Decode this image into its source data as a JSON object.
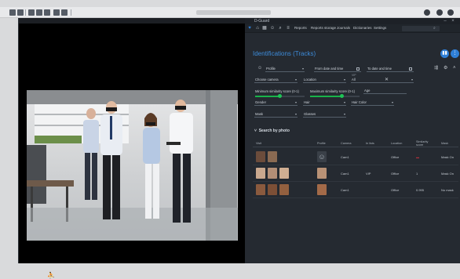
{
  "colors": {
    "accent": "#3d8bd9",
    "slider": "#19b34a",
    "background": "#252a31",
    "mask_text": "#b3303c"
  },
  "app": {
    "title": "D-Guard",
    "menu": [
      "Reports",
      "Reports storage",
      "Journals",
      "Dictionaries",
      "Settings"
    ]
  },
  "page": {
    "title": "Identifications (Tracks)"
  },
  "filters": {
    "profile": "Profile",
    "from_date": "From date and time",
    "to_date": "To date and time",
    "choose_camera": "Choose camera",
    "location": "Location",
    "vip_label": "VIP",
    "vip_value": "All",
    "min_similarity": "Minimum similarity score (0-1)",
    "max_similarity": "Maximum similarity score (0-1)",
    "age": "Age",
    "gender": "Gender",
    "hair": "Hair",
    "hair_color": "Hair Color",
    "mask": "Mask",
    "glasses": "Glasses",
    "min_similarity_level": 0.5,
    "max_similarity_level": 0.65
  },
  "search_by_photo": "Search by photo",
  "table": {
    "columns": [
      "Visit",
      "Profile",
      "Camera",
      "In lists",
      "Location",
      "Similarity score",
      "Mask"
    ],
    "rows": [
      {
        "camera": "Cam1",
        "lists": "",
        "location": "Office",
        "score": "",
        "mask": "Mask On",
        "score_red": true
      },
      {
        "camera": "Cam1",
        "lists": "VIP",
        "location": "Office",
        "score": "1",
        "mask": "Mask On",
        "score_red": false
      },
      {
        "camera": "Cam1",
        "lists": "",
        "location": "Office",
        "score": "0.995",
        "mask": "No mask",
        "score_red": false
      }
    ]
  },
  "icons": {
    "profile": "person-icon",
    "clear": "close-icon",
    "calendar": "calendar-icon",
    "menu": "hamburger-icon",
    "search": "search-icon",
    "settings": "gear-icon"
  }
}
